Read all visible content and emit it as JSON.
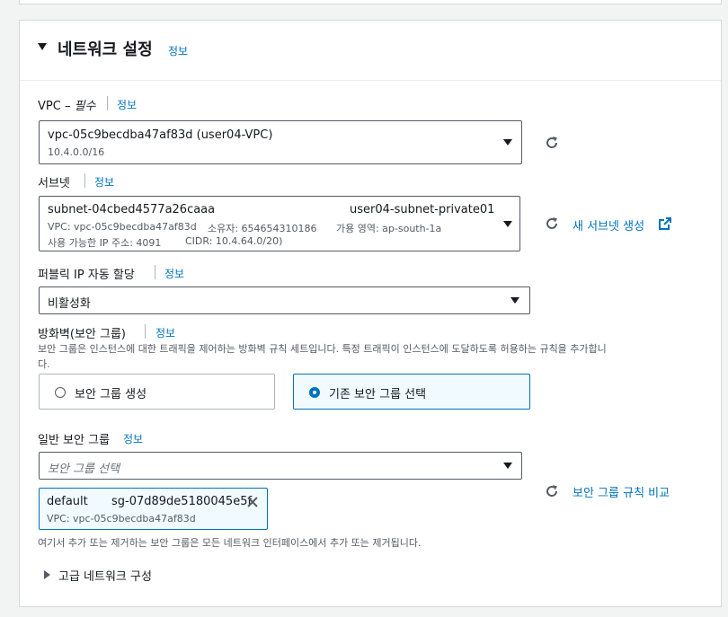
{
  "section": {
    "title": "네트워크 설정",
    "info": "정보"
  },
  "vpc": {
    "label": "VPC –",
    "required": "필수",
    "info": "정보",
    "value": "vpc-05c9becdba47af83d (user04-VPC)",
    "cidr": "10.4.0.0/16"
  },
  "subnet": {
    "label": "서브넷",
    "info": "정보",
    "id": "subnet-04cbed4577a26caaa",
    "name": "user04-subnet-private01",
    "vpc": "VPC: vpc-05c9becdba47af83d",
    "owner": "소유자: 654654310186",
    "az": "가용 영역: ap-south-1a",
    "ips": "사용 가능한 IP 주소: 4091",
    "cidr": "CIDR: 10.4.64.0/20)",
    "create_link": "새 서브넷 생성"
  },
  "public_ip": {
    "label": "퍼블릭 IP 자동 할당",
    "info": "정보",
    "value": "비활성화"
  },
  "firewall": {
    "label": "방화벽(보안 그룹)",
    "info": "정보",
    "description_line1": "보안 그룹은 인스턴스에 대한 트래픽을 제어하는 방화벽 규칙 세트입니다. 특정 트래픽이 인스턴스에 도달하도록 허용하는 규칙을 추가합니",
    "description_line2": "다.",
    "option_create": "보안 그룹 생성",
    "option_select": "기존 보안 그룹 선택"
  },
  "common_sg": {
    "label": "일반 보안 그룹",
    "info": "정보",
    "placeholder": "보안 그룹 선택",
    "token_name": "default",
    "token_id": "sg-07d89de5180045e5f",
    "token_vpc": "VPC: vpc-05c9becdba47af83d",
    "compare_link": "보안 그룹 규칙 비교",
    "note": "여기서 추가 또는 제거하는 보안 그룹은 모든 네트워크 인터페이스에서 추가 또는 제거됩니다."
  },
  "advanced": {
    "label": "고급 네트워크 구성"
  },
  "colors": {
    "link": "#0073bb",
    "selected_bg": "#f1faff",
    "border": "#545b64"
  }
}
